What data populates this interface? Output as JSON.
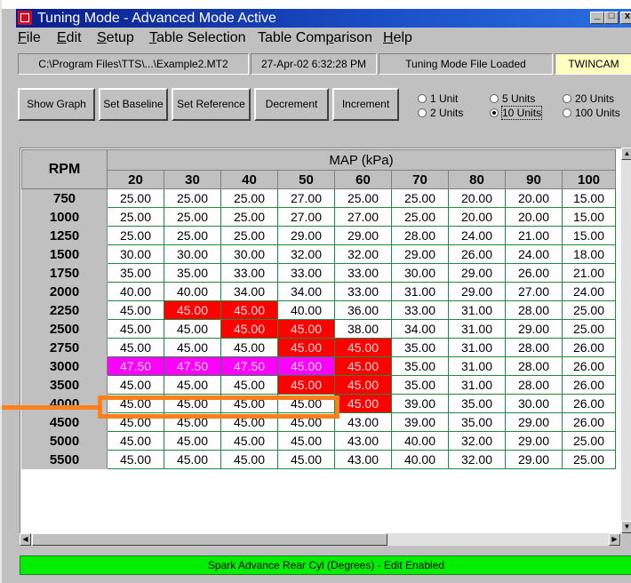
{
  "window": {
    "title": "Tuning Mode - Advanced Mode Active",
    "controls": {
      "minimize": "_",
      "maximize": "□",
      "close": "x"
    }
  },
  "menu": [
    {
      "pre": "",
      "u": "F",
      "post": "ile"
    },
    {
      "pre": "",
      "u": "E",
      "post": "dit"
    },
    {
      "pre": "",
      "u": "S",
      "post": "etup"
    },
    {
      "pre": "",
      "u": "T",
      "post": "able Selection"
    },
    {
      "pre": "Table Com",
      "u": "p",
      "post": "arison"
    },
    {
      "pre": "",
      "u": "H",
      "post": "elp"
    }
  ],
  "status": {
    "file_path": "C:\\Program Files\\TTS\\...\\Example2.MT2",
    "datetime": "27-Apr-02 6:32:28 PM",
    "message": "Tuning Mode File Loaded",
    "engine": "TWINCAM",
    "engine_color": "#ffffc0"
  },
  "toolbar": {
    "show_graph": "Show Graph",
    "set_baseline": "Set Baseline",
    "set_reference": "Set Reference",
    "decrement": "Decrement",
    "increment": "Increment"
  },
  "step_units": {
    "options": [
      "1 Unit",
      "2 Units",
      "5 Units",
      "10 Units",
      "20 Units",
      "100 Units"
    ],
    "selected": "10 Units"
  },
  "table": {
    "row_header": "RPM",
    "col_group_header": "MAP (kPa)",
    "map_columns": [
      "20",
      "30",
      "40",
      "50",
      "60",
      "70",
      "80",
      "90",
      "100"
    ],
    "rows": [
      {
        "rpm": "750",
        "values": [
          "25.00",
          "25.00",
          "25.00",
          "27.00",
          "25.00",
          "25.00",
          "20.00",
          "20.00",
          "15.00"
        ]
      },
      {
        "rpm": "1000",
        "values": [
          "25.00",
          "25.00",
          "25.00",
          "27.00",
          "27.00",
          "25.00",
          "20.00",
          "20.00",
          "15.00"
        ]
      },
      {
        "rpm": "1250",
        "values": [
          "25.00",
          "25.00",
          "25.00",
          "29.00",
          "29.00",
          "28.00",
          "24.00",
          "21.00",
          "15.00"
        ]
      },
      {
        "rpm": "1500",
        "values": [
          "30.00",
          "30.00",
          "30.00",
          "32.00",
          "32.00",
          "29.00",
          "26.00",
          "24.00",
          "18.00"
        ]
      },
      {
        "rpm": "1750",
        "values": [
          "35.00",
          "35.00",
          "33.00",
          "33.00",
          "33.00",
          "30.00",
          "29.00",
          "26.00",
          "21.00"
        ]
      },
      {
        "rpm": "2000",
        "values": [
          "40.00",
          "40.00",
          "34.00",
          "34.00",
          "33.00",
          "31.00",
          "29.00",
          "27.00",
          "24.00"
        ]
      },
      {
        "rpm": "2250",
        "values": [
          "45.00",
          "45.00",
          "45.00",
          "40.00",
          "36.00",
          "33.00",
          "31.00",
          "28.00",
          "25.00"
        ]
      },
      {
        "rpm": "2500",
        "values": [
          "45.00",
          "45.00",
          "45.00",
          "45.00",
          "38.00",
          "34.00",
          "31.00",
          "29.00",
          "25.00"
        ]
      },
      {
        "rpm": "2750",
        "values": [
          "45.00",
          "45.00",
          "45.00",
          "45.00",
          "45.00",
          "35.00",
          "31.00",
          "28.00",
          "26.00"
        ]
      },
      {
        "rpm": "3000",
        "values": [
          "47.50",
          "47.50",
          "47.50",
          "45.00",
          "45.00",
          "35.00",
          "31.00",
          "28.00",
          "26.00"
        ]
      },
      {
        "rpm": "3500",
        "values": [
          "45.00",
          "45.00",
          "45.00",
          "45.00",
          "45.00",
          "35.00",
          "31.00",
          "28.00",
          "26.00"
        ]
      },
      {
        "rpm": "4000",
        "values": [
          "45.00",
          "45.00",
          "45.00",
          "45.00",
          "45.00",
          "39.00",
          "35.00",
          "30.00",
          "26.00"
        ]
      },
      {
        "rpm": "4500",
        "values": [
          "45.00",
          "45.00",
          "45.00",
          "45.00",
          "43.00",
          "39.00",
          "35.00",
          "29.00",
          "26.00"
        ]
      },
      {
        "rpm": "5000",
        "values": [
          "45.00",
          "45.00",
          "45.00",
          "45.00",
          "43.00",
          "40.00",
          "32.00",
          "29.00",
          "25.00"
        ]
      },
      {
        "rpm": "5500",
        "values": [
          "45.00",
          "45.00",
          "45.00",
          "45.00",
          "43.00",
          "40.00",
          "32.00",
          "29.00",
          "25.00"
        ]
      }
    ],
    "highlight_colors": {
      "red": "#ff0000",
      "magenta": "#ff00ff",
      "callout": "#ff7f1a"
    },
    "red_cells": [
      [
        6,
        1
      ],
      [
        6,
        2
      ],
      [
        7,
        2
      ],
      [
        7,
        3
      ],
      [
        8,
        3
      ],
      [
        8,
        4
      ],
      [
        9,
        4
      ],
      [
        10,
        3
      ],
      [
        10,
        4
      ],
      [
        11,
        4
      ]
    ],
    "magenta_cells": [
      [
        9,
        0
      ],
      [
        9,
        1
      ],
      [
        9,
        2
      ],
      [
        9,
        3
      ]
    ],
    "callout_row": 9
  },
  "mode_bar": {
    "text": "Spark Advance Rear Cyl (Degrees) - Edit Enabled",
    "color": "#00ee00"
  }
}
